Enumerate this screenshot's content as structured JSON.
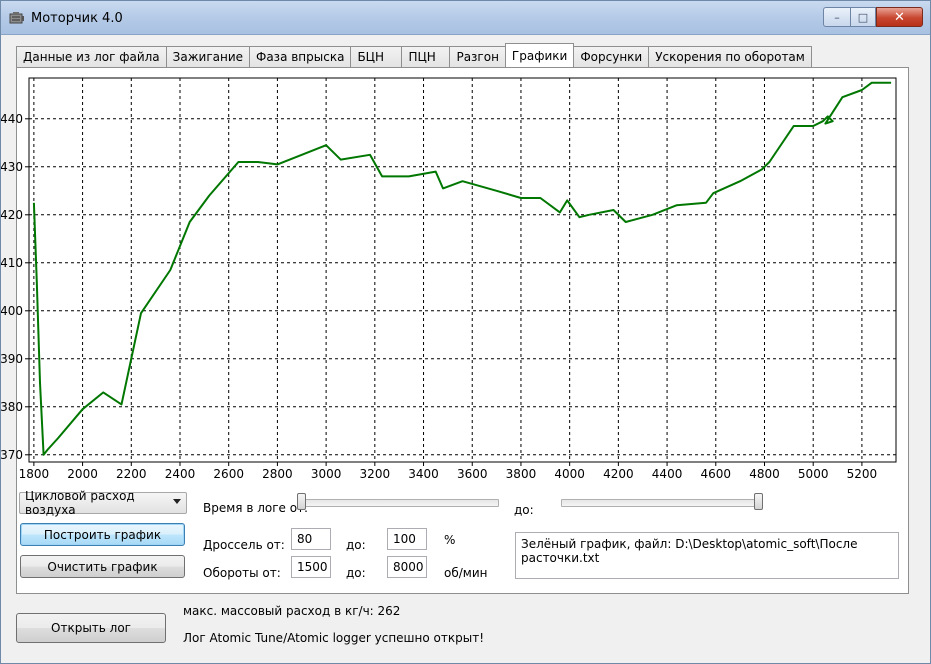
{
  "window": {
    "title": "Моторчик 4.0",
    "icon": "engine-icon",
    "controls": {
      "minimize": "–",
      "maximize": "□",
      "close": "✕"
    }
  },
  "tabs": [
    {
      "label": "Данные из лог файла",
      "active": false
    },
    {
      "label": "Зажигание",
      "active": false
    },
    {
      "label": "Фаза впрыска",
      "active": false
    },
    {
      "label": "БЦН",
      "active": false
    },
    {
      "label": "ПЦН",
      "active": false
    },
    {
      "label": "Разгон",
      "active": false
    },
    {
      "label": "Графики",
      "active": true
    },
    {
      "label": "Форсунки",
      "active": false
    },
    {
      "label": "Ускорения по оборотам",
      "active": false
    }
  ],
  "chart_data": {
    "type": "line",
    "xlim": [
      1780,
      5340
    ],
    "ylim": [
      368.5,
      448.5
    ],
    "x_ticks": [
      1800,
      2000,
      2200,
      2400,
      2600,
      2800,
      3000,
      3200,
      3400,
      3600,
      3800,
      4000,
      4200,
      4400,
      4600,
      4800,
      5000,
      5200
    ],
    "y_ticks": [
      370,
      380,
      390,
      400,
      410,
      420,
      430,
      440
    ],
    "grid": true,
    "series": [
      {
        "color": "#007700",
        "x": [
          1800,
          1812,
          1825,
          1840,
          1855,
          1900,
          2000,
          2085,
          2160,
          2240,
          2360,
          2440,
          2520,
          2640,
          2720,
          2800,
          2900,
          3000,
          3060,
          3180,
          3230,
          3340,
          3450,
          3480,
          3560,
          3700,
          3800,
          3880,
          3960,
          3990,
          4040,
          4080,
          4180,
          4230,
          4340,
          4440,
          4560,
          4590,
          4700,
          4790,
          4820,
          4920,
          5000,
          5040,
          5060,
          5080,
          5050,
          5120,
          5200,
          5240,
          5320
        ],
        "y": [
          422.5,
          406.0,
          385.0,
          370.0,
          371.0,
          373.5,
          379.5,
          383.0,
          380.5,
          399.5,
          408.5,
          418.5,
          424.0,
          431.0,
          431.0,
          430.5,
          432.5,
          434.5,
          431.5,
          432.5,
          428.0,
          428.0,
          429.0,
          425.5,
          427.0,
          425.0,
          423.5,
          423.5,
          420.5,
          423.0,
          419.5,
          420.0,
          421.0,
          418.5,
          420.0,
          422.0,
          422.5,
          424.5,
          427.0,
          429.5,
          431.0,
          438.5,
          438.5,
          439.5,
          440.5,
          439.5,
          439.0,
          444.5,
          446.0,
          447.5,
          447.5
        ]
      }
    ]
  },
  "controls": {
    "param_select": {
      "value": "Цикловой расход воздуха"
    },
    "build_button": "Построить график",
    "clear_button": "Очистить график",
    "time_label": "Время в логе от:",
    "to_label": "до:",
    "time_from_level": 0.0,
    "time_to_level": 1.0,
    "throttle_label": "Дроссель от:",
    "throttle_from": "80",
    "throttle_to": "100",
    "throttle_unit": "%",
    "rpm_label": "Обороты от:",
    "rpm_from": "1500",
    "rpm_to": "8000",
    "rpm_unit": "об/мин",
    "info_memo": "Зелёный график, файл: D:\\Desktop\\atomic_soft\\После расточки.txt"
  },
  "footer": {
    "open_button": "Открыть лог",
    "max_flow": "макс. массовый расход в кг/ч: 262",
    "status": "Лог Atomic Tune/Atomic logger успешно открыт!"
  }
}
